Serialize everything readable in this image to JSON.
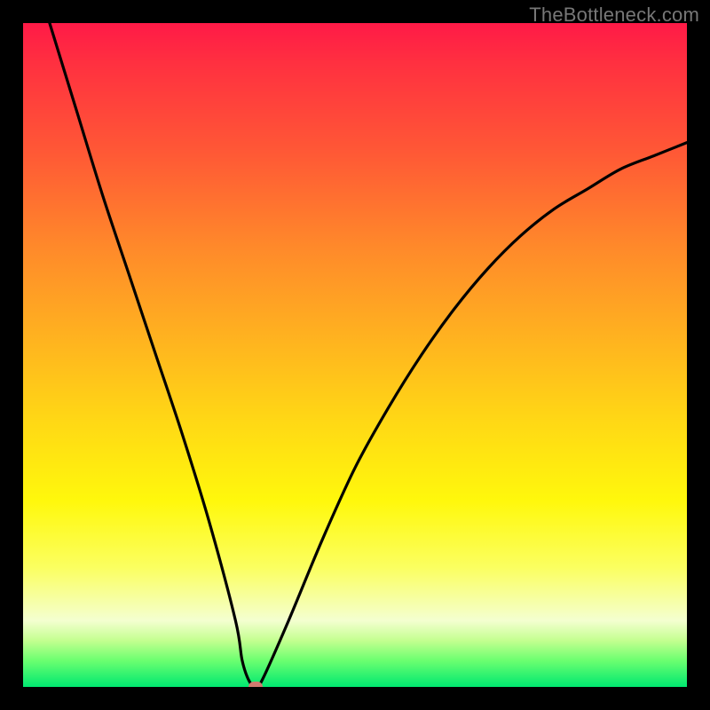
{
  "watermark": "TheBottleneck.com",
  "chart_data": {
    "type": "line",
    "title": "",
    "xlabel": "",
    "ylabel": "",
    "xlim": [
      0,
      100
    ],
    "ylim": [
      0,
      100
    ],
    "grid": false,
    "legend": false,
    "series": [
      {
        "name": "bottleneck-curve",
        "x": [
          4,
          8,
          12,
          16,
          20,
          24,
          28,
          32,
          33,
          34,
          35,
          36,
          40,
          45,
          50,
          55,
          60,
          65,
          70,
          75,
          80,
          85,
          90,
          95,
          100
        ],
        "y": [
          100,
          87,
          74,
          62,
          50,
          38,
          25,
          10,
          4,
          1,
          0,
          1,
          10,
          22,
          33,
          42,
          50,
          57,
          63,
          68,
          72,
          75,
          78,
          80,
          82
        ]
      }
    ],
    "minimum_marker": {
      "x": 35,
      "y": 0
    },
    "background": {
      "type": "vertical-gradient",
      "stops": [
        {
          "pos": 0,
          "color": "#ff1a47"
        },
        {
          "pos": 50,
          "color": "#ffd815"
        },
        {
          "pos": 100,
          "color": "#00e870"
        }
      ]
    }
  },
  "colors": {
    "curve": "#000000",
    "marker": "#d07a6f",
    "frame": "#000000"
  }
}
